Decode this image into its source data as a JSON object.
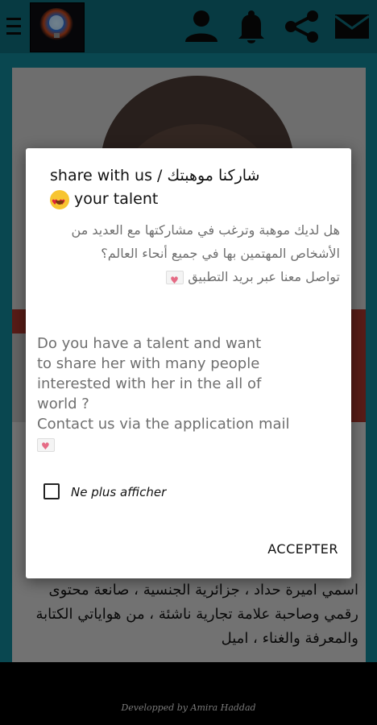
{
  "topbar": {
    "menu_icon": "hamburger-menu-icon",
    "logo_icon": "app-logo",
    "icons": [
      "user-profile-icon",
      "bell-notification-icon",
      "share-icon",
      "mail-envelope-icon"
    ],
    "color": "#0e6b78"
  },
  "background_card": {
    "text": "اسمي اميرة حداد ، جزائرية الجنسية ، صانعة محتوى رقمي وصاحبة علامة تجارية ناشئة ، من هواياتي الكتابة والمعرفة والغناء ، اميل"
  },
  "dialog": {
    "title_line1": "شاركنا موهبتك / share with us",
    "title_line2": "your talent",
    "title_emoji": "smiling-face-with-heart-eyes-icon",
    "arabic_body": "هل لديك موهبة وترغب في مشاركتها مع العديد من الأشخاص المهتمين بها في جميع أنحاء العالم؟",
    "arabic_contact": "تواصل معنا عبر بريد التطبيق",
    "english_body_line1": "Do you have a talent and want",
    "english_body_line2": "to share her with many people",
    "english_body_line3": "interested with her in the all of",
    "english_body_line4": "world ?",
    "english_contact": "Contact us via the application mail",
    "mail_emoji": "love-letter-icon",
    "checkbox_label": "Ne plus afficher",
    "checkbox_checked": false,
    "accept_label": "ACCEPTER"
  },
  "footer": {
    "credit": "Developped by Amira Haddad"
  }
}
